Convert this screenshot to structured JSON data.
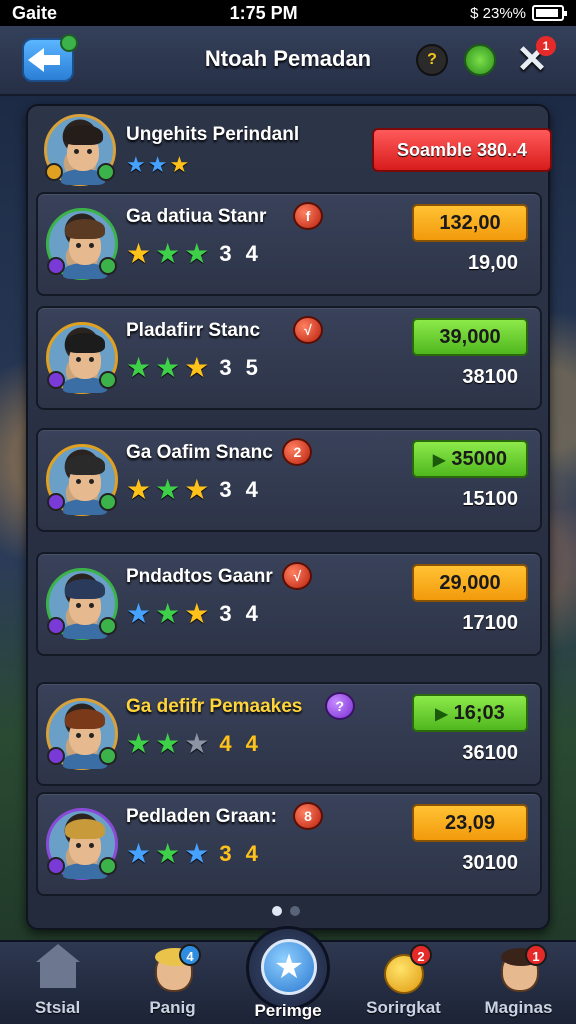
{
  "status_bar": {
    "carrier": "Gaite",
    "time": "1:75 PM",
    "battery_text": "$ 23%%"
  },
  "top_bar": {
    "title": "Ntoah Pemadan",
    "coin_glyph": "?",
    "close_glyph": "✕",
    "close_badge": "1"
  },
  "header": {
    "name": "Ungehits Perindanl",
    "stars": [
      "blue",
      "blue",
      "gold"
    ],
    "action_label": "Soamble 380..4"
  },
  "rows": [
    {
      "name": "Ga datiua Stanr",
      "name_color": "white",
      "heart_glyph": "f",
      "heart_color": "red",
      "stars": [
        "gold",
        "green",
        "green"
      ],
      "rating": "3 4",
      "rating_color": "white",
      "value": "132,00",
      "value_style": "orange",
      "value_play": false,
      "sub_value": "19,00"
    },
    {
      "name": "Pladafirr Stanc",
      "name_color": "white",
      "heart_glyph": "√",
      "heart_color": "red",
      "stars": [
        "green",
        "green",
        "gold"
      ],
      "rating": "3 5",
      "rating_color": "white",
      "value": "39,000",
      "value_style": "green",
      "value_play": false,
      "sub_value": "38100"
    },
    {
      "name": "Ga Oafim Snanc",
      "name_color": "white",
      "heart_glyph": "2",
      "heart_color": "red",
      "stars": [
        "gold",
        "green",
        "gold"
      ],
      "rating": "3 4",
      "rating_color": "white",
      "value": "35000",
      "value_style": "green",
      "value_play": true,
      "sub_value": "15100"
    },
    {
      "name": "Pndadtos Gaanr",
      "name_color": "white",
      "heart_glyph": "√",
      "heart_color": "red",
      "stars": [
        "blue",
        "green",
        "gold"
      ],
      "rating": "3 4",
      "rating_color": "white",
      "value": "29,000",
      "value_style": "orange",
      "value_play": false,
      "sub_value": "17100"
    },
    {
      "name": "Ga defifr Pemaakes",
      "name_color": "gold",
      "heart_glyph": "?",
      "heart_color": "purple",
      "stars": [
        "green",
        "green",
        "gray"
      ],
      "rating": "4 4",
      "rating_color": "gold",
      "value": "16;03",
      "value_style": "green",
      "value_play": true,
      "sub_value": "36100"
    },
    {
      "name": "Pedladen Graan:",
      "name_color": "white",
      "heart_glyph": "8",
      "heart_color": "red",
      "stars": [
        "blue",
        "green",
        "blue"
      ],
      "rating": "3 4",
      "rating_color": "gold",
      "value": "23,09",
      "value_style": "orange",
      "value_play": false,
      "sub_value": "30100"
    }
  ],
  "pagination": {
    "pages": 2,
    "active": 0
  },
  "bottom_nav": [
    {
      "label": "Stsial",
      "icon": "home-icon",
      "badge": ""
    },
    {
      "label": "Panig",
      "icon": "avatar-icon",
      "badge": "4"
    },
    {
      "label": "Perimge",
      "icon": "star-icon",
      "badge": ""
    },
    {
      "label": "Sorirgkat",
      "icon": "coin-icon",
      "badge": "2"
    },
    {
      "label": "Maginas",
      "icon": "avatar-icon",
      "badge": "1"
    }
  ]
}
